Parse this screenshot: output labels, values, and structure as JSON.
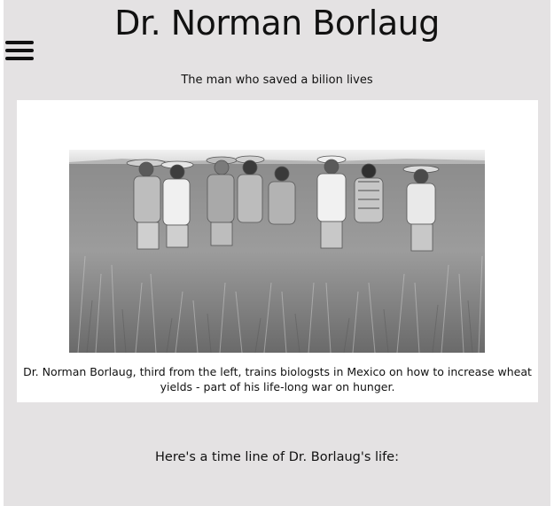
{
  "header": {
    "title": "Dr. Norman Borlaug",
    "menu_icon": "hamburger-menu-icon"
  },
  "intro": {
    "tagline": "The man who saved a bilion lives"
  },
  "figure": {
    "caption": "Dr. Norman Borlaug, third from the left, trains biologsts in Mexico on how to increase wheat yields - part of his life-long war on hunger."
  },
  "timeline": {
    "heading": "Here's a time line of Dr. Borlaug's life:"
  }
}
